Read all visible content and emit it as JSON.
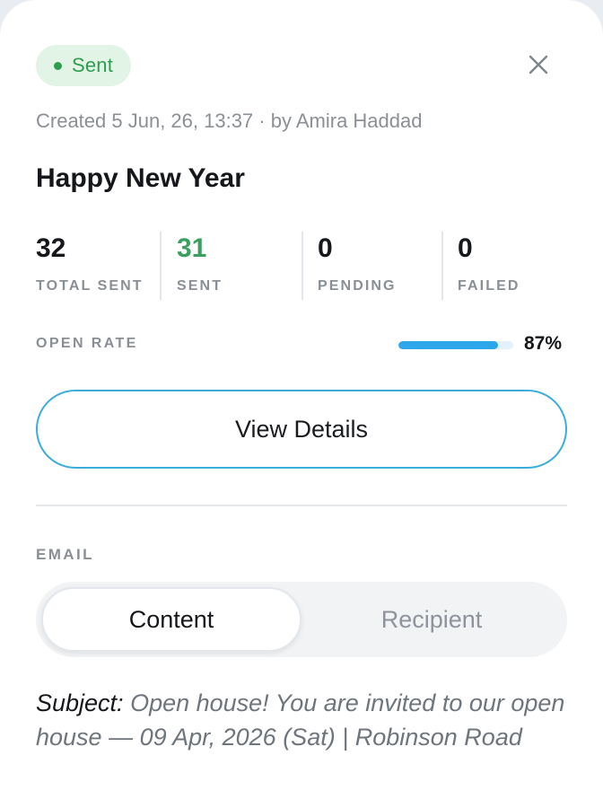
{
  "status": {
    "label": "Sent",
    "color": "#2e9d50",
    "dot_color": "#2e9d50",
    "background": "#e2f4e6"
  },
  "close": {
    "icon": "close-icon"
  },
  "meta": {
    "created_line": "Created 5 Jun, 26, 13:37 · by Amira Haddad"
  },
  "campaign": {
    "title": "Happy New Year"
  },
  "stats": [
    {
      "value": "32",
      "label": "TOTAL SENT",
      "color": "#15171a"
    },
    {
      "value": "31",
      "label": "SENT",
      "color": "#3aa05e"
    },
    {
      "value": "0",
      "label": "PENDING",
      "color": "#15171a"
    },
    {
      "value": "0",
      "label": "FAILED",
      "color": "#15171a"
    }
  ],
  "open_rate": {
    "label": "OPEN RATE",
    "value_text": "87%",
    "fraction": 0.87,
    "bar_color": "#2ea6ec"
  },
  "actions": {
    "view_details_label": "View Details"
  },
  "email": {
    "section_label": "EMAIL",
    "tabs": [
      {
        "label": "Content",
        "active": true
      },
      {
        "label": "Recipient",
        "active": false
      }
    ],
    "subject_key": "Subject:",
    "subject_value": " Open house! You are invited to our open house — 09 Apr, 2026 (Sat) | Robinson Road"
  },
  "colors": {
    "accent": "#3aaed8",
    "text_primary": "#15171a",
    "text_muted": "#8a8f96"
  }
}
